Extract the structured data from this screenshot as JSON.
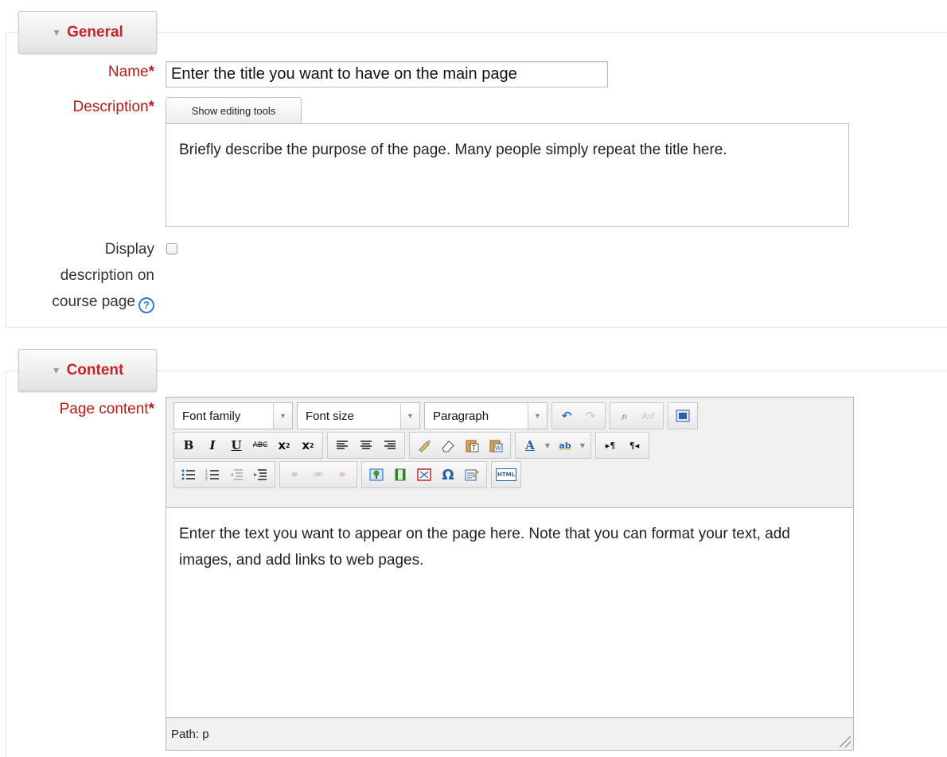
{
  "general": {
    "legend": "General",
    "name_label": "Name",
    "name_value": "Enter the title you want to have on the main page",
    "description_label": "Description",
    "show_editing_tools": "Show editing tools",
    "description_value": "Briefly describe the purpose of the page. Many people simply repeat the title here.",
    "display_label_1": "Display",
    "display_label_2": "description on",
    "display_label_3": "course page",
    "display_checked": false,
    "required_mark": "*"
  },
  "content": {
    "legend": "Content",
    "page_content_label": "Page content",
    "font_family": "Font family",
    "font_size": "Font size",
    "format": "Paragraph",
    "body_text": "Enter the text you want to appear on the page here. Note that you can format your text, add images, and add links to web pages.",
    "path": "Path: p"
  },
  "toolbar": {
    "bold": "B",
    "italic": "I",
    "underline": "U",
    "strikethrough": "ABC",
    "html": "HTML",
    "omega": "Ω"
  },
  "colors": {
    "label_red": "#b31b1b",
    "legend_red": "#c0262a",
    "help_blue": "#2f7cd6"
  }
}
